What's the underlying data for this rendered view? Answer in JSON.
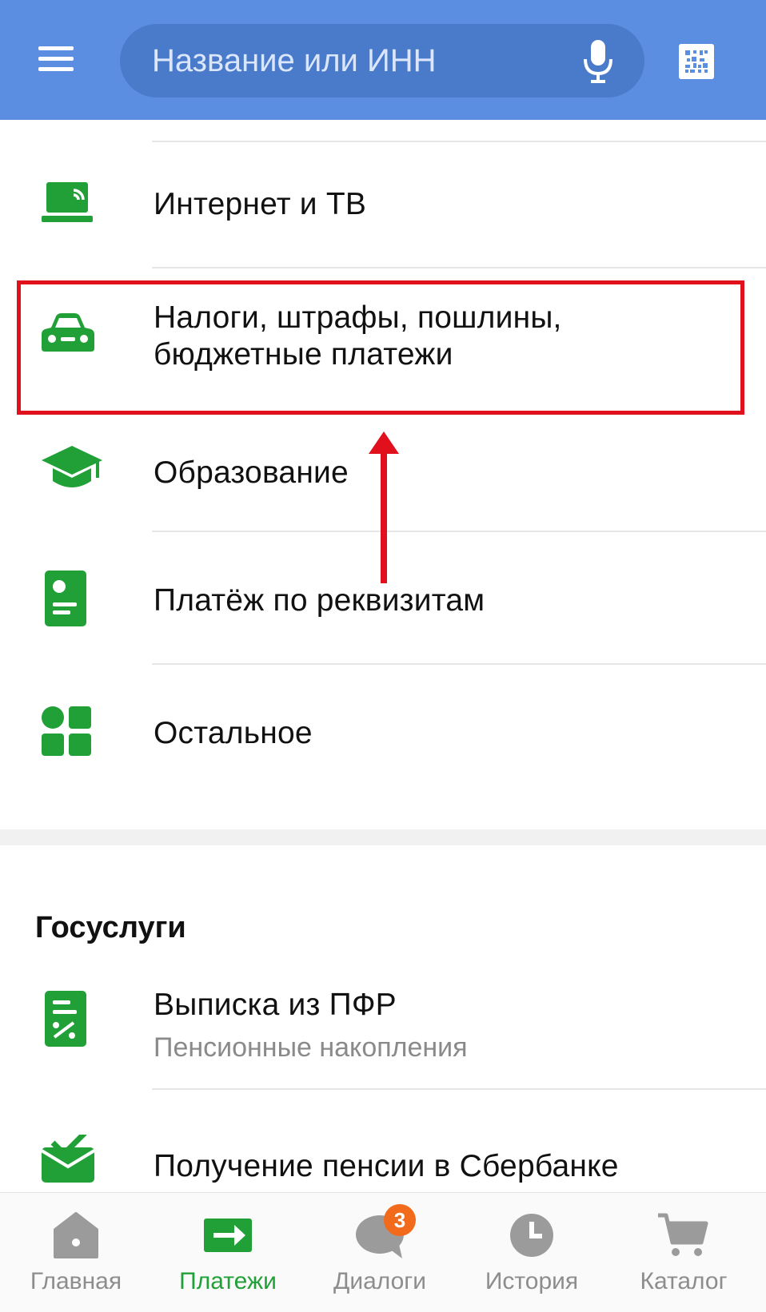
{
  "search": {
    "placeholder": "Название или ИНН"
  },
  "categories": [
    {
      "label": "Интернет и ТВ",
      "icon": "laptop-icon"
    },
    {
      "label_line1": "Налоги, штрафы, пошлины,",
      "label_line2": "бюджетные платежи",
      "icon": "car-icon"
    },
    {
      "label": "Образование",
      "icon": "graduation-cap-icon"
    },
    {
      "label": "Платёж по реквизитам",
      "icon": "id-card-icon"
    },
    {
      "label": "Остальное",
      "icon": "grid-icon"
    }
  ],
  "gosuslugi": {
    "title": "Госуслуги",
    "items": [
      {
        "label": "Выписка из ПФР",
        "sublabel": "Пенсионные накопления",
        "icon": "document-percent-icon"
      },
      {
        "label": "Получение пенсии в Сбербанке",
        "icon": "envelope-check-icon"
      }
    ]
  },
  "bottom_nav": [
    {
      "label": "Главная",
      "icon": "home-icon"
    },
    {
      "label": "Платежи",
      "icon": "payment-arrow-icon",
      "active": true
    },
    {
      "label": "Диалоги",
      "icon": "chat-icon",
      "badge": "3"
    },
    {
      "label": "История",
      "icon": "clock-icon"
    },
    {
      "label": "Каталог",
      "icon": "cart-icon"
    }
  ],
  "colors": {
    "header": "#5b8ee0",
    "accent_green": "#21a038",
    "highlight_red": "#e0101c",
    "badge_orange": "#f26a1b"
  }
}
